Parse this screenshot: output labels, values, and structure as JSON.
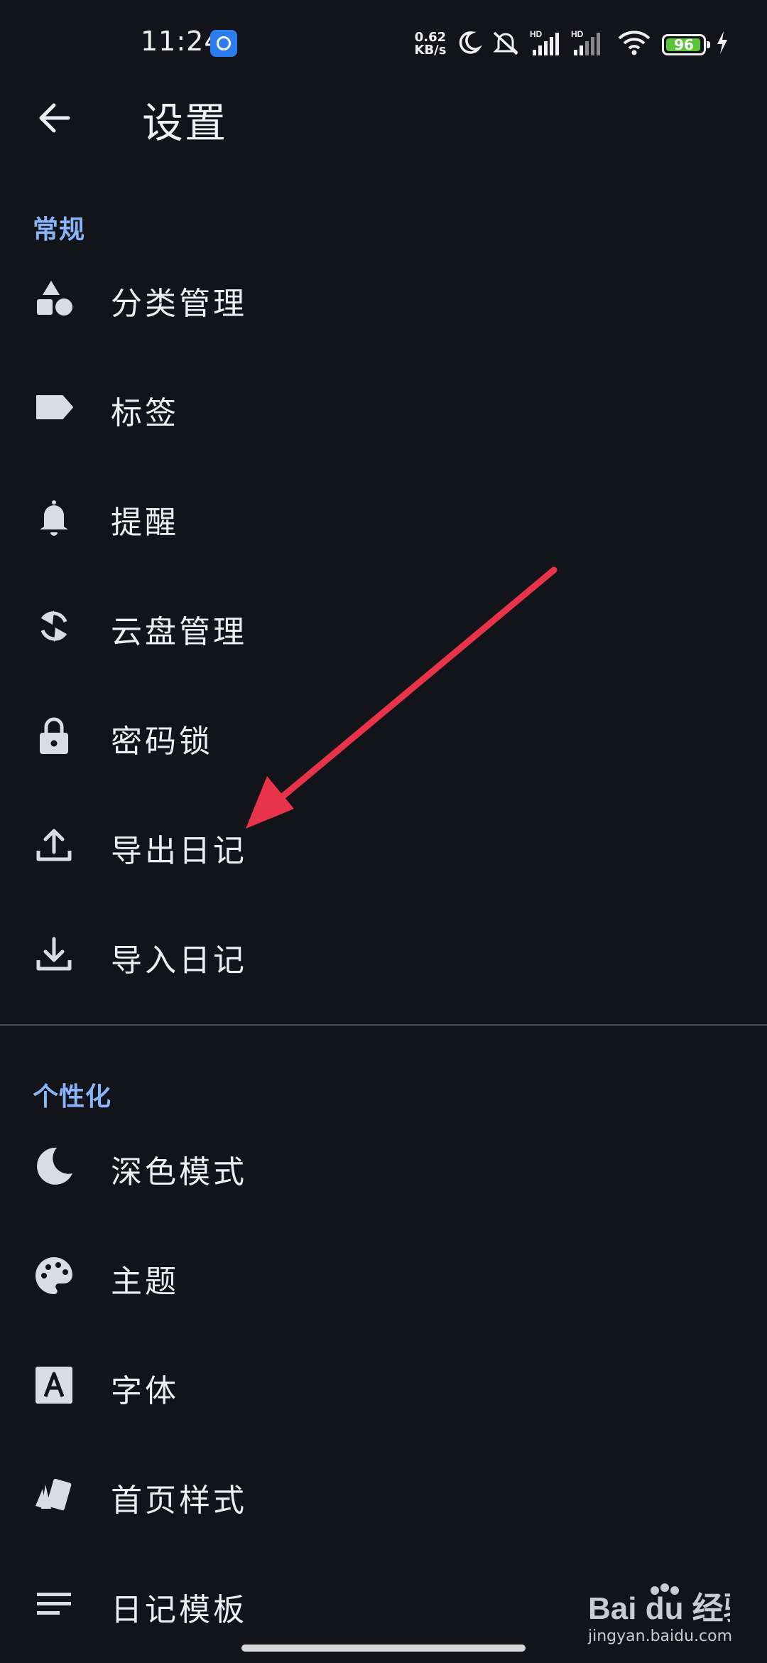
{
  "status_bar": {
    "time": "11:24",
    "net_speed_value": "0.62",
    "net_speed_unit": "KB/s",
    "signal1_label": "HD",
    "signal2_label": "HD",
    "battery_level": "96",
    "battery_fraction": 0.96
  },
  "app_bar": {
    "title": "设置",
    "back_icon": "arrow-left-icon"
  },
  "sections": {
    "general": {
      "header": "常规",
      "items": [
        {
          "label": "分类管理",
          "icon": "shapes-icon"
        },
        {
          "label": "标签",
          "icon": "label-icon"
        },
        {
          "label": "提醒",
          "icon": "bell-icon"
        },
        {
          "label": "云盘管理",
          "icon": "sync-icon"
        },
        {
          "label": "密码锁",
          "icon": "lock-icon"
        },
        {
          "label": "导出日记",
          "icon": "upload-icon"
        },
        {
          "label": "导入日记",
          "icon": "download-icon"
        }
      ]
    },
    "personalization": {
      "header": "个性化",
      "items": [
        {
          "label": "深色模式",
          "icon": "moon-icon"
        },
        {
          "label": "主题",
          "icon": "palette-icon"
        },
        {
          "label": "字体",
          "icon": "font-icon"
        },
        {
          "label": "首页样式",
          "icon": "cards-icon"
        },
        {
          "label": "日记模板",
          "icon": "notes-icon"
        }
      ]
    }
  },
  "annotation": {
    "arrow_color": "#e8344a",
    "points_to": "导出日记"
  },
  "watermark": {
    "brand": "Bai du 经验",
    "url": "jingyan.baidu.com"
  },
  "colors": {
    "background": "#121419",
    "accent": "#8ab4f8",
    "text": "#eceef4",
    "icon": "#dadce3"
  }
}
